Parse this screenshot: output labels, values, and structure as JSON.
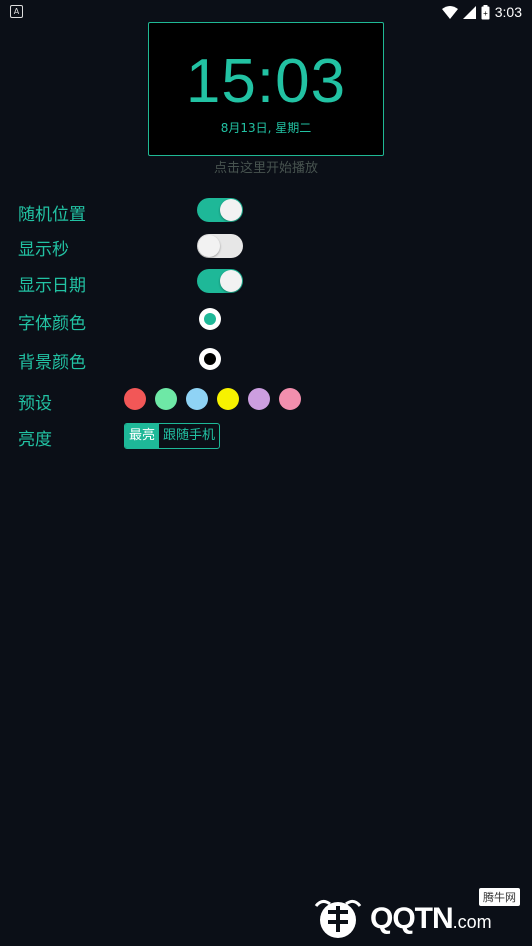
{
  "status_bar": {
    "app_icon": "A",
    "time": "3:03",
    "icons": [
      "wifi-icon",
      "signal-icon",
      "battery-icon"
    ]
  },
  "clock": {
    "time": "15:03",
    "date": "8月13日, 星期二",
    "hint": "点击这里开始播放"
  },
  "settings": {
    "random_position": {
      "label": "随机位置",
      "on": true
    },
    "show_seconds": {
      "label": "显示秒",
      "on": false
    },
    "show_date": {
      "label": "显示日期",
      "on": true
    },
    "font_color": {
      "label": "字体颜色",
      "color": "#1eb898"
    },
    "background_color": {
      "label": "背景颜色",
      "color": "#000000"
    },
    "presets": {
      "label": "预设",
      "colors": [
        "#f25757",
        "#6ee8a6",
        "#8fd3f5",
        "#f7f200",
        "#cc9ee0",
        "#f28fae"
      ]
    },
    "brightness": {
      "label": "亮度",
      "options": [
        "最亮",
        "跟随手机"
      ],
      "selected": "最亮"
    }
  },
  "watermark": {
    "text": "QQTN",
    "suffix": ".com",
    "badge": "腾牛网"
  },
  "colors": {
    "accent": "#1eb898",
    "background": "#0b0f17"
  }
}
